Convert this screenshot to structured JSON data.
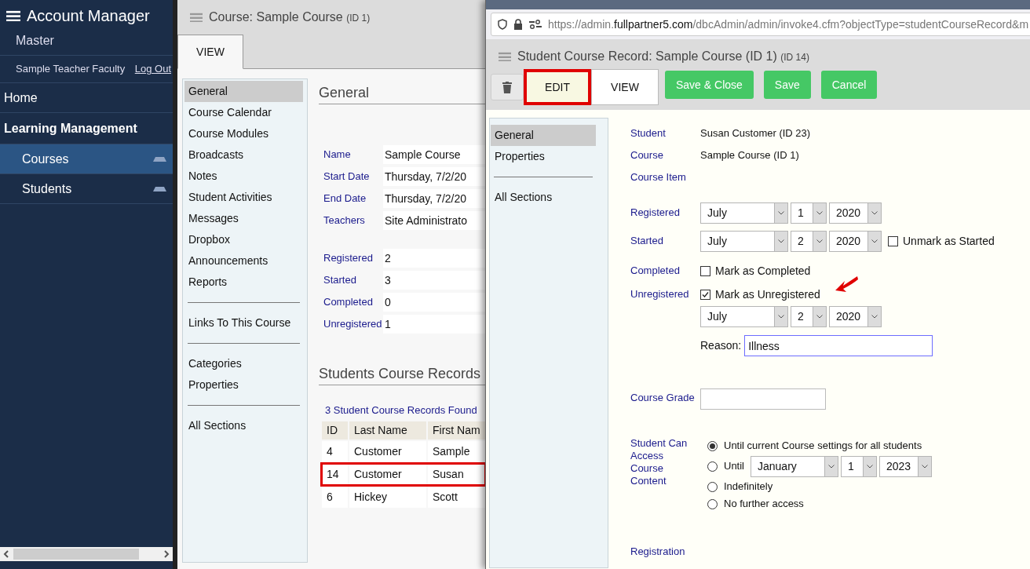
{
  "sidebar": {
    "title": "Account Manager",
    "account": "Master",
    "user": "Sample Teacher Faculty",
    "logout": "Log Out",
    "items": [
      {
        "label": "Home",
        "kind": "link",
        "selected": false
      },
      {
        "label": "Learning Management",
        "kind": "section",
        "selected": false
      },
      {
        "label": "Courses",
        "kind": "sub",
        "selected": true
      },
      {
        "label": "Students",
        "kind": "sub",
        "selected": false
      }
    ]
  },
  "course": {
    "title": "Course: Sample Course",
    "title_id": "(ID 1)",
    "tabs": [
      {
        "label": "VIEW",
        "selected": true
      }
    ],
    "nav_groups": [
      [
        {
          "label": "General",
          "selected": true
        },
        {
          "label": "Course Calendar",
          "selected": false
        },
        {
          "label": "Course Modules",
          "selected": false
        },
        {
          "label": "Broadcasts",
          "selected": false
        },
        {
          "label": "Notes",
          "selected": false
        },
        {
          "label": "Student Activities",
          "selected": false
        },
        {
          "label": "Messages",
          "selected": false
        },
        {
          "label": "Dropbox",
          "selected": false
        },
        {
          "label": "Announcements",
          "selected": false
        },
        {
          "label": "Reports",
          "selected": false
        }
      ],
      [
        {
          "label": "Links To This Course",
          "selected": false
        }
      ],
      [
        {
          "label": "Categories",
          "selected": false
        },
        {
          "label": "Properties",
          "selected": false
        }
      ],
      [
        {
          "label": "All Sections",
          "selected": false
        }
      ]
    ],
    "heading": "General",
    "fields": [
      {
        "label": "Name",
        "value": "Sample Course"
      },
      {
        "label": "Start Date",
        "value": "Thursday, 7/2/20"
      },
      {
        "label": "End Date",
        "value": "Thursday, 7/2/20"
      },
      {
        "label": "Teachers",
        "value": "Site Administrato"
      }
    ],
    "counts": [
      {
        "label": "Registered",
        "value": "2"
      },
      {
        "label": "Started",
        "value": "3"
      },
      {
        "label": "Completed",
        "value": "0"
      },
      {
        "label": "Unregistered",
        "value": "1"
      }
    ],
    "records_heading": "Students Course Records",
    "records_found": "3 Student Course Records Found",
    "columns": [
      "ID",
      "Last Name",
      "First Nam"
    ],
    "rows": [
      {
        "cells": [
          "4",
          "Customer",
          "Sample"
        ],
        "highlighted": false
      },
      {
        "cells": [
          "14",
          "Customer",
          "Susan"
        ],
        "highlighted": true
      },
      {
        "cells": [
          "6",
          "Hickey",
          "Scott"
        ],
        "highlighted": false
      }
    ]
  },
  "popup": {
    "url": {
      "scheme": "https://admin.",
      "domain": "fullpartner5.com",
      "path": "/dbcAdmin/admin/invoke4.cfm?objectType=studentCourseRecord&m"
    },
    "title": "Student Course Record: Sample Course (ID 1)",
    "title_id": "(ID 14)",
    "tabs": [
      {
        "label": "EDIT",
        "selected": true,
        "highlighted": true
      },
      {
        "label": "VIEW",
        "selected": false,
        "highlighted": false
      }
    ],
    "buttons": [
      "Save & Close",
      "Save",
      "Cancel"
    ],
    "nav_groups": [
      [
        {
          "label": "General",
          "selected": true
        },
        {
          "label": "Properties",
          "selected": false
        }
      ],
      [
        {
          "label": "All Sections",
          "selected": false
        }
      ]
    ],
    "student": {
      "label": "Student",
      "value": "Susan Customer (ID 23)"
    },
    "course": {
      "label": "Course",
      "value": "Sample Course (ID 1)"
    },
    "course_item": {
      "label": "Course Item"
    },
    "registered": {
      "label": "Registered",
      "month": "July",
      "day": "1",
      "year": "2020"
    },
    "started": {
      "label": "Started",
      "month": "July",
      "day": "2",
      "year": "2020",
      "checkbox": {
        "label": "Unmark as Started",
        "checked": false
      }
    },
    "completed": {
      "label": "Completed",
      "checkbox": {
        "label": "Mark as Completed",
        "checked": false
      }
    },
    "unregistered": {
      "label": "Unregistered",
      "checkbox": {
        "label": "Mark as Unregistered",
        "checked": true
      },
      "month": "July",
      "day": "2",
      "year": "2020",
      "reason_label": "Reason:",
      "reason": "Illness"
    },
    "grade": {
      "label": "Course Grade"
    },
    "access": {
      "label": "Student Can Access Course Content",
      "options": [
        {
          "kind": "plain",
          "label": "Until current Course settings for all students",
          "selected": true
        },
        {
          "kind": "date",
          "label": "Until",
          "month": "January",
          "day": "1",
          "year": "2023",
          "selected": false
        },
        {
          "kind": "plain",
          "label": "Indefinitely",
          "selected": false
        },
        {
          "kind": "plain",
          "label": "No further access",
          "selected": false
        }
      ]
    },
    "registration": {
      "label": "Registration"
    }
  }
}
